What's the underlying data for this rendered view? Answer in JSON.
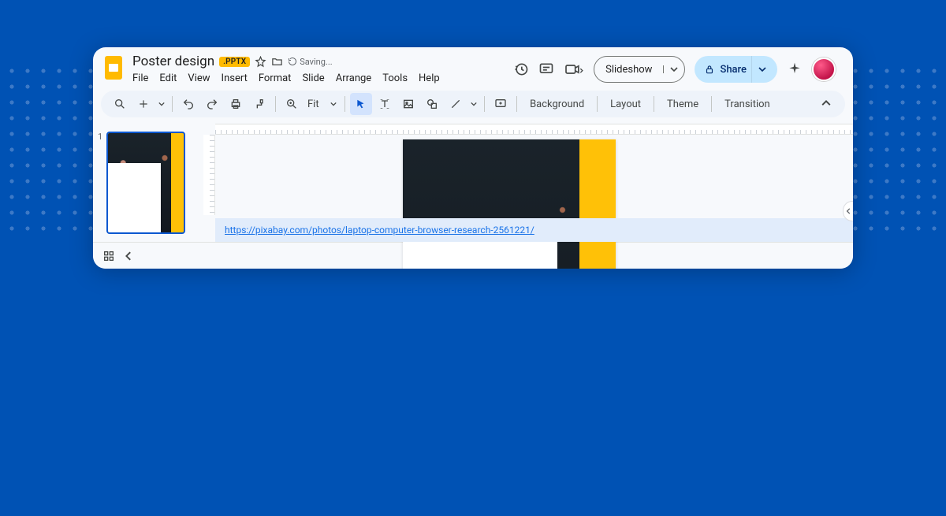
{
  "header": {
    "title": "Poster design",
    "badge": ".PPTX",
    "status": "Saving..."
  },
  "menus": [
    "File",
    "Edit",
    "View",
    "Insert",
    "Format",
    "Slide",
    "Arrange",
    "Tools",
    "Help"
  ],
  "topButtons": {
    "slideshow": "Slideshow",
    "share": "Share"
  },
  "toolbar": {
    "zoom": "Fit",
    "background": "Background",
    "layout": "Layout",
    "theme": "Theme",
    "transition": "Transition"
  },
  "slideNumber": "1",
  "speakerLink": "https://pixabay.com/photos/laptop-computer-browser-research-2561221/"
}
